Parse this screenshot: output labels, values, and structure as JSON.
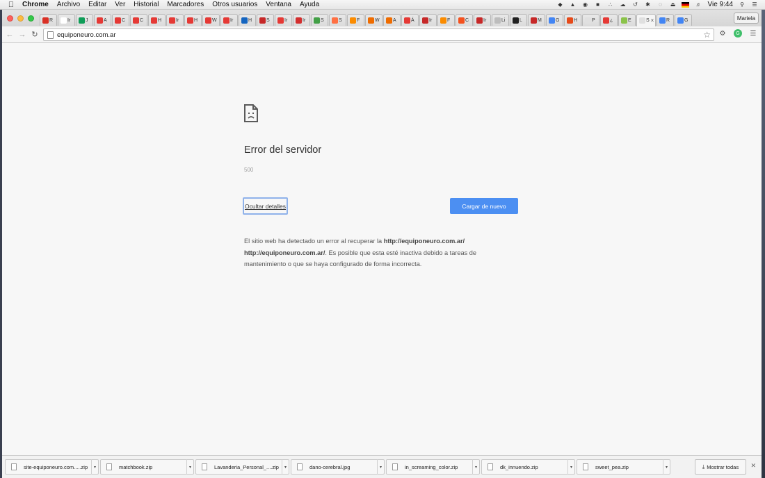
{
  "menubar": {
    "app": "Chrome",
    "items": [
      "Archivo",
      "Editar",
      "Ver",
      "Historial",
      "Marcadores",
      "Otros usuarios",
      "Ventana",
      "Ayuda"
    ],
    "clock": "Vie 9:44"
  },
  "tabs": [
    {
      "label": "R",
      "color": "#d93025"
    },
    {
      "label": "Ir",
      "color": "#ffffff"
    },
    {
      "label": "J",
      "color": "#0f9d58"
    },
    {
      "label": "A",
      "color": "#e53935"
    },
    {
      "label": "C",
      "color": "#e53935"
    },
    {
      "label": "C",
      "color": "#e53935"
    },
    {
      "label": "H",
      "color": "#e53935"
    },
    {
      "label": "Ir",
      "color": "#e53935"
    },
    {
      "label": "H",
      "color": "#e53935"
    },
    {
      "label": "W",
      "color": "#e53935"
    },
    {
      "label": "Ir",
      "color": "#e53935"
    },
    {
      "label": "H",
      "color": "#1565c0"
    },
    {
      "label": "S",
      "color": "#c62828"
    },
    {
      "label": "Ir",
      "color": "#e53935"
    },
    {
      "label": "Ir",
      "color": "#d32f2f"
    },
    {
      "label": "S",
      "color": "#43a047"
    },
    {
      "label": "S",
      "color": "#ff7043"
    },
    {
      "label": "F",
      "color": "#fb8c00"
    },
    {
      "label": "W",
      "color": "#ef6c00"
    },
    {
      "label": "A",
      "color": "#ef6c00"
    },
    {
      "label": "Á",
      "color": "#e53935"
    },
    {
      "label": "Ir",
      "color": "#c62828"
    },
    {
      "label": "F",
      "color": "#fb8c00"
    },
    {
      "label": "C",
      "color": "#f4511e"
    },
    {
      "label": "Ir",
      "color": "#c62828"
    },
    {
      "label": "Li",
      "color": "#bdbdbd"
    },
    {
      "label": "L",
      "color": "#212121"
    },
    {
      "label": "M",
      "color": "#c62828"
    },
    {
      "label": "G",
      "color": "#4285f4"
    },
    {
      "label": "H",
      "color": "#e64a19"
    },
    {
      "label": "P",
      "color": "#e0e0e0"
    },
    {
      "label": "¿",
      "color": "#e53935"
    },
    {
      "label": "E",
      "color": "#8bc34a"
    },
    {
      "label": "S",
      "color": "#e0e0e0",
      "active": true
    },
    {
      "label": "R",
      "color": "#4285f4"
    },
    {
      "label": "G",
      "color": "#4285f4"
    }
  ],
  "profile": "Mariela",
  "url": "equiponeuro.com.ar",
  "error": {
    "title": "Error del servidor",
    "code": "500",
    "details_button": "Ocultar detalles",
    "reload_button": "Cargar de nuevo",
    "desc_pre": "El sitio web ha detectado un error al recuperar la ",
    "desc_url": "http://equiponeuro.com.ar/ http://equiponeuro.com.ar/",
    "desc_post": ". Es posible que esta esté inactiva debido a tareas de mantenimiento o que se haya configurado de forma incorrecta."
  },
  "downloads": [
    "site-equiponeuro.com.....zip",
    "matchbook.zip",
    "Lavanderia_Personal_....zip",
    "dano-cerebral.jpg",
    "in_screaming_color.zip",
    "dk_innuendo.zip",
    "sweet_pea.zip"
  ],
  "show_all": "Mostrar todas"
}
